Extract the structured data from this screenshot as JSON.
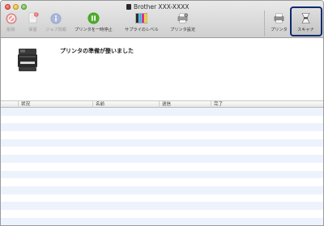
{
  "window": {
    "title": "Brother XXX-XXXX"
  },
  "toolbar": {
    "items": [
      {
        "label": "削除",
        "icon": "delete-icon",
        "enabled": false
      },
      {
        "label": "保留",
        "icon": "hold-icon",
        "enabled": false
      },
      {
        "label": "ジョブ情報",
        "icon": "job-info-icon",
        "enabled": false
      },
      {
        "label": "プリンタを一時停止",
        "icon": "pause-icon",
        "enabled": true
      },
      {
        "label": "サプライのレベル",
        "icon": "supply-levels-icon",
        "enabled": true
      },
      {
        "label": "プリンタ設定",
        "icon": "printer-settings-icon",
        "enabled": true
      }
    ],
    "printer_tab_label": "プリンタ",
    "scanner_tab_label": "スキャナ"
  },
  "status": {
    "text": "プリンタの準備が整いました"
  },
  "table": {
    "headers": [
      "状況",
      "名前",
      "送信",
      "完了"
    ]
  },
  "colors": {
    "accent": "#0d2a6e",
    "stripe": "#edf3fc",
    "pause_green": "#4cae2a",
    "delete_red": "#e36d6d"
  }
}
